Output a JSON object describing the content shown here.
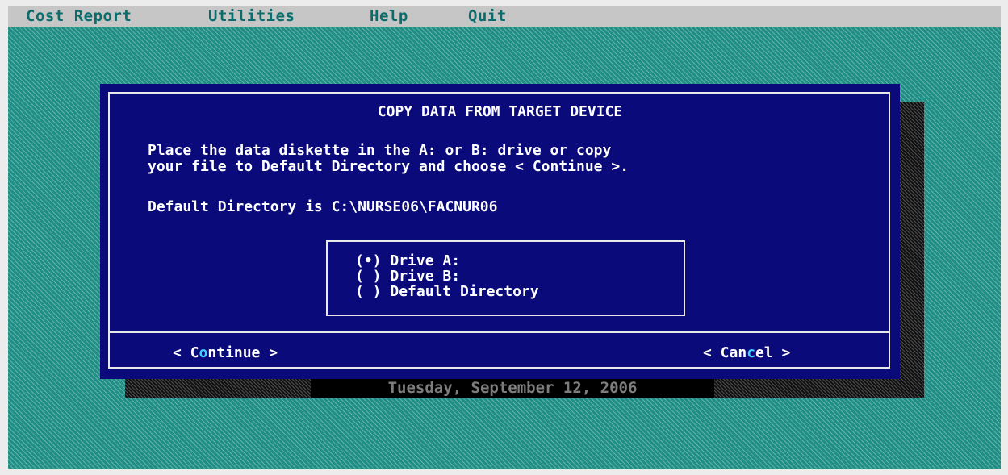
{
  "menu": {
    "items": [
      "Cost Report",
      "Utilities",
      "Help",
      "Quit"
    ]
  },
  "dialog": {
    "title": "COPY DATA FROM TARGET DEVICE",
    "instruction_line1": "Place the data diskette in the A: or B: drive or copy",
    "instruction_line2": "your file to Default Directory and choose < Continue >.",
    "directory_line": "Default Directory is C:\\NURSE06\\FACNUR06",
    "options": [
      {
        "marker": "(•)",
        "label": "Drive A:",
        "selected": true
      },
      {
        "marker": "( )",
        "label": "Drive B:",
        "selected": false
      },
      {
        "marker": "( )",
        "label": "Default Directory",
        "selected": false
      }
    ],
    "continue_button": {
      "pre": "< C",
      "hot": "o",
      "post": "ntinue >"
    },
    "cancel_button": {
      "pre": "< Can",
      "hot": "c",
      "post": "el >"
    }
  },
  "status": {
    "date": "Tuesday, September 12, 2006"
  },
  "colors": {
    "desktop": "#1f8f86",
    "dialog": "#0a0a7a",
    "hotkey": "#3fd0ff",
    "menu_text": "#0a6d6d"
  }
}
